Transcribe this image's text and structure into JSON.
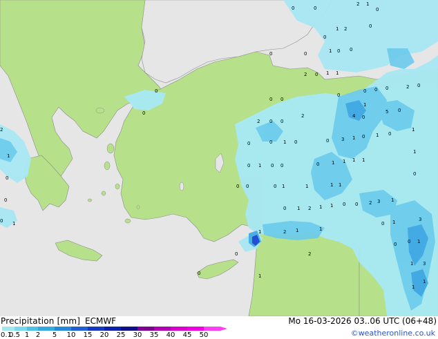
{
  "legend": {
    "title": "Precipitation [mm]",
    "model": "ECMWF",
    "datetime": "Mo 16-03-2026 03..06 UTC (06+48)",
    "credit": "©weatheronline.co.uk",
    "scale_colors": [
      "#a0e8f0",
      "#78d8ec",
      "#50c0e8",
      "#38a8e0",
      "#2888d8",
      "#2060d0",
      "#1838c0",
      "#1020a8",
      "#101088",
      "#800090",
      "#b000b0",
      "#d800c8",
      "#f000e0",
      "#ff40f0"
    ],
    "scale_labels": [
      "0.1",
      "0.5",
      "1",
      "2",
      "5",
      "10",
      "15",
      "20",
      "25",
      "30",
      "35",
      "40",
      "45",
      "50"
    ]
  },
  "map_values": [
    "0",
    "2",
    "1",
    "0",
    "0",
    "1",
    "2",
    "0",
    "0",
    "1",
    "0",
    "0",
    "2",
    "0",
    "1",
    "1",
    "0",
    "0",
    "2",
    "0",
    "0",
    "0",
    "0",
    "0",
    "0",
    "0",
    "2",
    "0",
    "1",
    "0",
    "5",
    "4",
    "0",
    "0",
    "2",
    "0",
    "1",
    "0",
    "0",
    "3",
    "1",
    "0",
    "1",
    "1",
    "0",
    "1",
    "0",
    "0",
    "1",
    "0",
    "0",
    "0",
    "1",
    "1",
    "1",
    "1",
    "0",
    "0",
    "1",
    "1",
    "0",
    "0",
    "1",
    "1",
    "2",
    "3",
    "1",
    "0",
    "1",
    "2",
    "1",
    "1",
    "0",
    "1",
    "2",
    "0",
    "1",
    "1",
    "3",
    "2",
    "1",
    "0",
    "0",
    "1",
    "3",
    "1",
    "0",
    "1",
    "0",
    "0",
    "1",
    "1",
    "0",
    "2",
    "1",
    "0",
    "0",
    "0",
    "1",
    "0"
  ]
}
